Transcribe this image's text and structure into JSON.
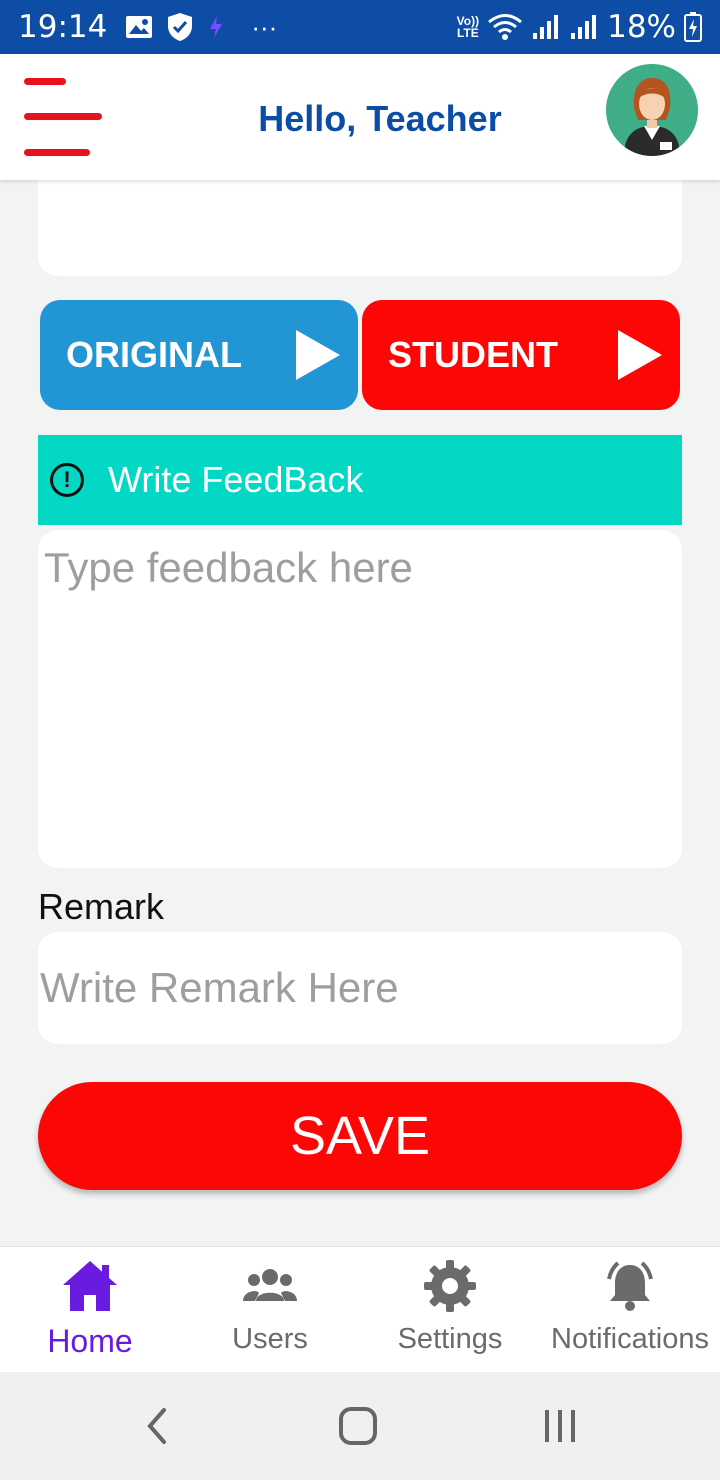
{
  "status_bar": {
    "time": "19:14",
    "battery": "18%",
    "network": "Vo)) LTE"
  },
  "header": {
    "greeting": "Hello, Teacher"
  },
  "tabs": {
    "original_label": "ORIGINAL",
    "student_label": "STUDENT"
  },
  "feedback": {
    "title": "Write FeedBack",
    "placeholder": "Type feedback here",
    "alert_glyph": "!"
  },
  "remark": {
    "label": "Remark",
    "placeholder": "Write Remark Here"
  },
  "save_label": "SAVE",
  "bottom_nav": {
    "items": [
      {
        "label": "Home",
        "icon": "home-icon",
        "active": true
      },
      {
        "label": "Users",
        "icon": "users-icon",
        "active": false
      },
      {
        "label": "Settings",
        "icon": "gear-icon",
        "active": false
      },
      {
        "label": "Notifications",
        "icon": "bell-icon",
        "active": false
      }
    ]
  },
  "colors": {
    "header_text": "#0b4da6",
    "accent_red": "#fd0606",
    "accent_blue": "#2296d4",
    "feedback_bar": "#03d8c5",
    "active_nav": "#6a1be0"
  }
}
